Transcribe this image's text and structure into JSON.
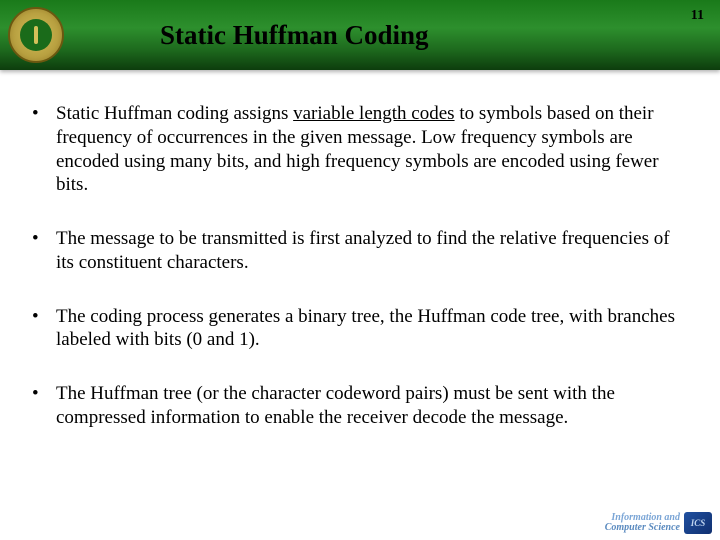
{
  "header": {
    "title": "Static Huffman Coding",
    "page_number": "11"
  },
  "bullets": [
    {
      "pre": "Static Huffman coding assigns ",
      "kw": "variable length codes",
      "post": " to symbols based on their frequency of occurrences in the given message. Low frequency symbols are encoded using many bits, and high frequency symbols are encoded using fewer bits."
    },
    {
      "pre": "The message to be transmitted is first analyzed to find the relative frequencies of its constituent characters.",
      "kw": "",
      "post": ""
    },
    {
      "pre": "The coding process generates a binary tree, the Huffman code tree, with branches labeled with bits (0 and 1).",
      "kw": "",
      "post": ""
    },
    {
      "pre": "The Huffman tree (or the character codeword pairs) must be sent with the compressed information to enable the receiver decode the message.",
      "kw": "",
      "post": ""
    }
  ],
  "footer": {
    "line1": "Information and",
    "line2": "Computer Science",
    "badge": "ICS"
  },
  "bullet_char": "•"
}
